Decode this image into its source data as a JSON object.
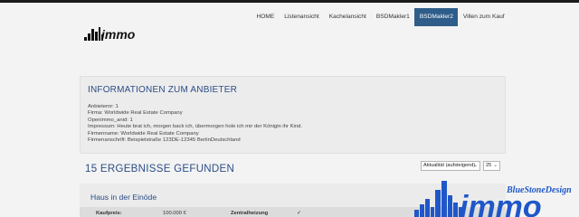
{
  "colors": {
    "accent": "#2f5d8a",
    "heading": "#2b4d86",
    "topbar": "#1a1a1a"
  },
  "logo": {
    "text": "immo"
  },
  "nav": {
    "items": [
      {
        "label": "HOME",
        "active": false
      },
      {
        "label": "Listenansicht",
        "active": false
      },
      {
        "label": "Kachelansicht",
        "active": false
      },
      {
        "label": "BSDMakler1",
        "active": false
      },
      {
        "label": "BSDMakler2",
        "active": true
      },
      {
        "label": "Villen zum Kauf",
        "active": false
      }
    ]
  },
  "provider": {
    "title": "INFORMATIONEN ZUM ANBIETER",
    "lines": [
      "Anbieternr: 1",
      "Firma: Worldwide Real Estate Company",
      "Openimmo_anid: 1",
      "Impressum: Heute brat ich, morgen back ich, übermorgen hole ich mir der Königin ihr Kind.",
      "Firmenname: Worldwide Real Estate Company",
      "Firmenanschrift: Beispielstraße 123DE-12345 BerlinDeutschland"
    ]
  },
  "results": {
    "heading": "15 ERGEBNISSE GEFUNDEN",
    "sort_value": "Aktualität (aufsteigend)",
    "per_page_value": "25"
  },
  "listing": {
    "title": "Haus in der Einöde",
    "price_label": "Kaufpreis:",
    "price_value": "100.000 €",
    "heating_label": "Zentralheizung",
    "heating_value": "✓"
  },
  "watermark": {
    "brand": "BlueStoneDesign",
    "word": "immo"
  }
}
